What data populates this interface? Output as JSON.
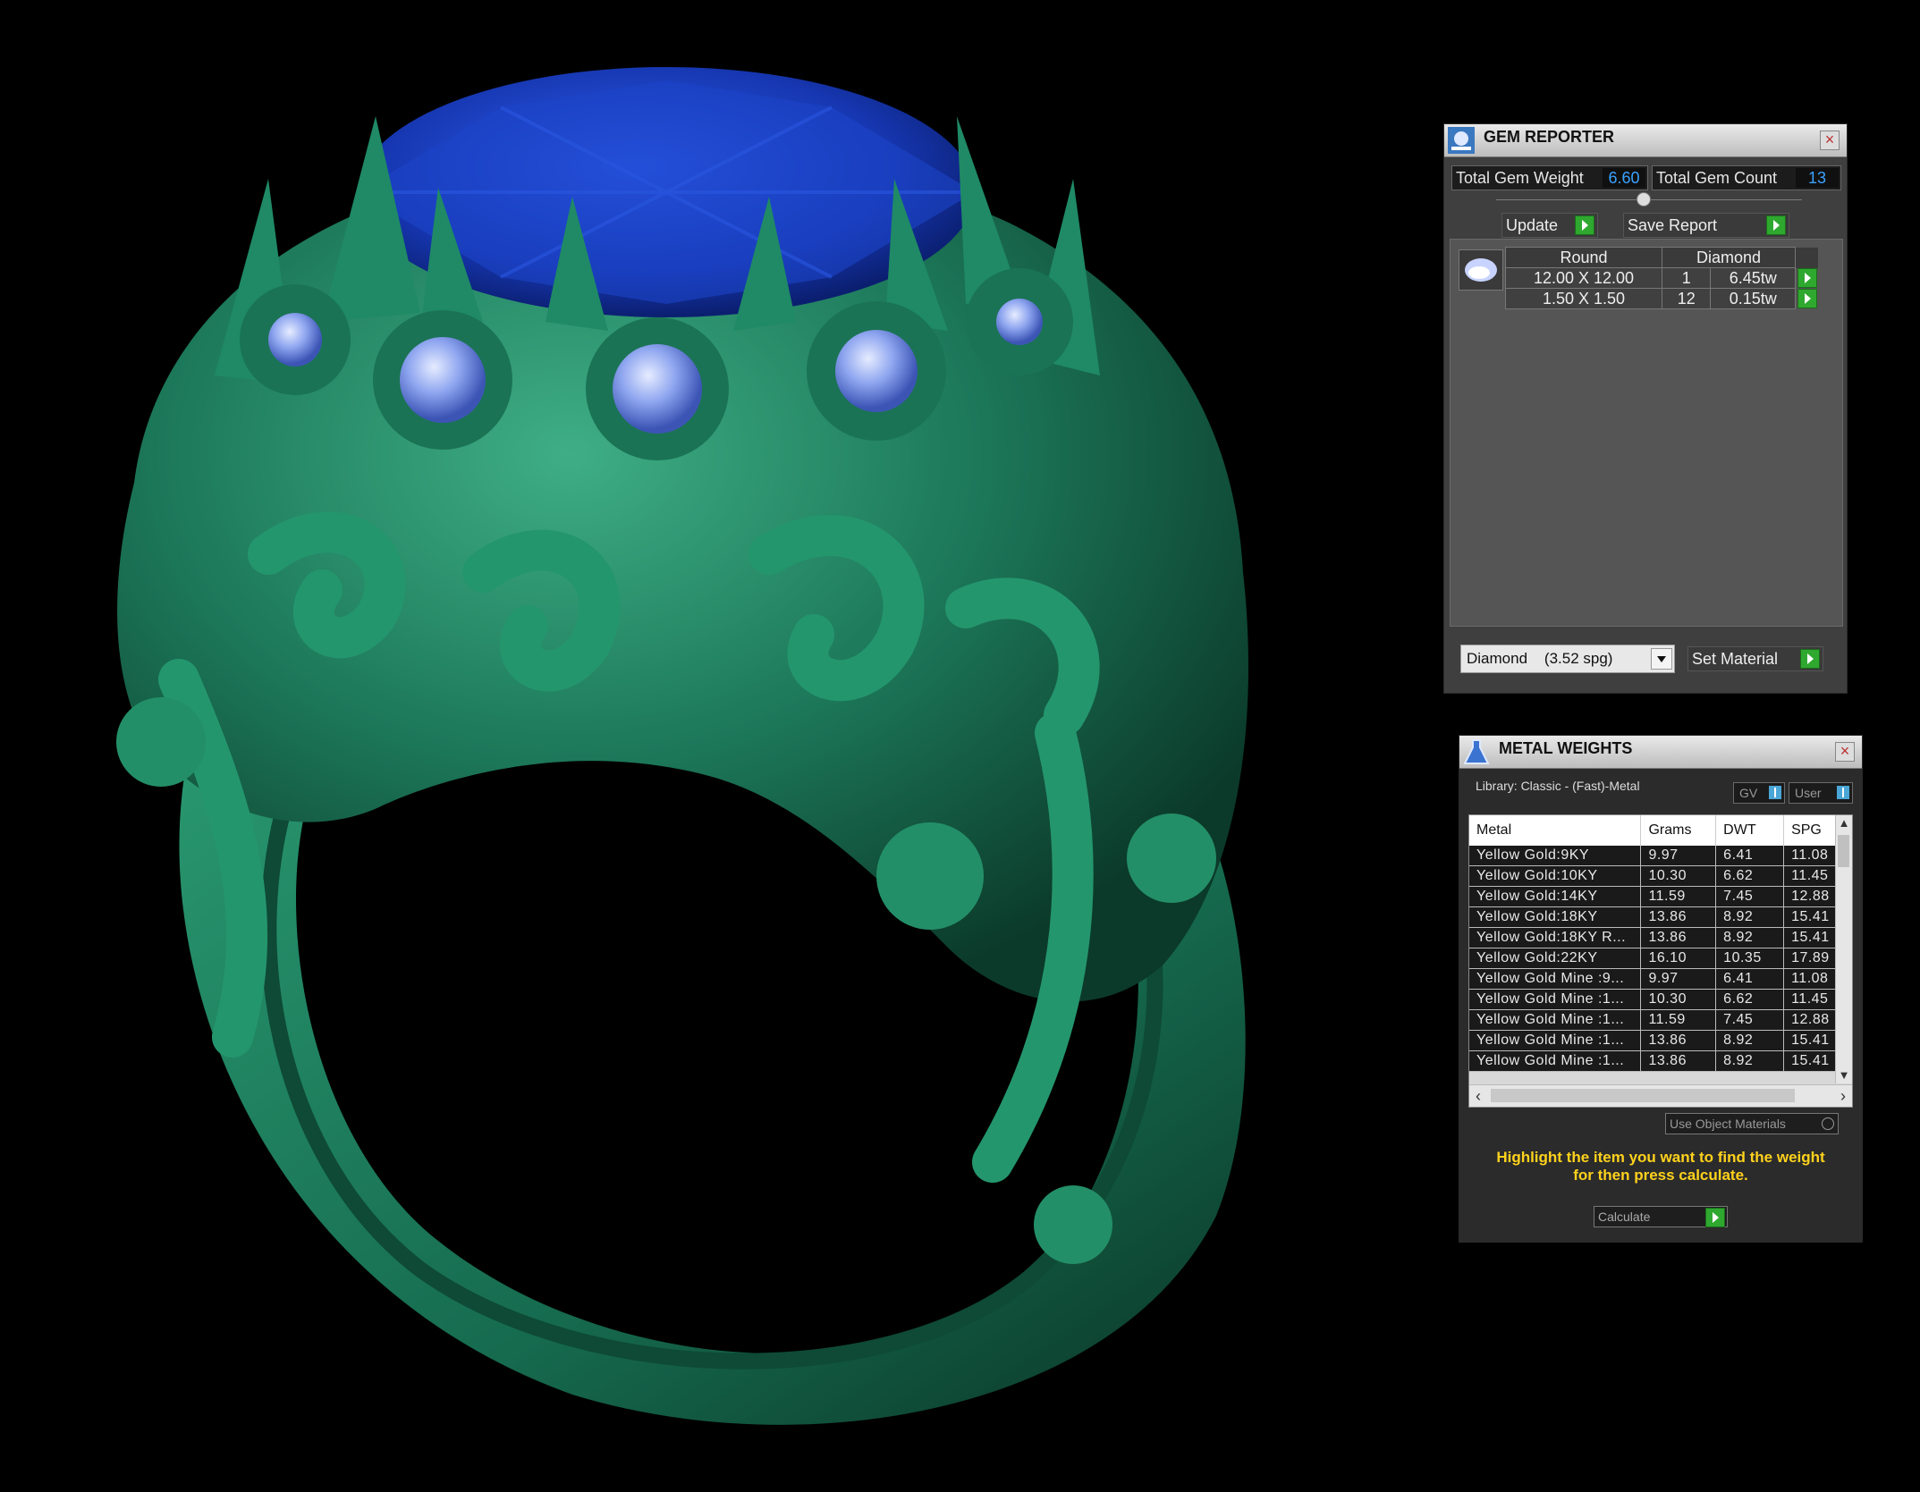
{
  "gem_reporter": {
    "title": "GEM REPORTER",
    "total_weight_label": "Total Gem Weight",
    "total_weight_value": "6.60",
    "total_count_label": "Total Gem Count",
    "total_count_value": "13",
    "update_label": "Update",
    "save_report_label": "Save Report",
    "table_headers": [
      "Round",
      "Diamond"
    ],
    "rows": [
      {
        "size": "12.00 X 12.00",
        "count": "1",
        "weight": "6.45tw"
      },
      {
        "size": "1.50 X 1.50",
        "count": "12",
        "weight": "0.15tw"
      }
    ],
    "material_select": "Diamond    (3.52 spg)",
    "set_material_label": "Set Material"
  },
  "metal_weights": {
    "title": "METAL WEIGHTS",
    "library": "Library: Classic - (Fast)-Metal",
    "toggle_gv": "GV",
    "toggle_user": "User",
    "columns": [
      "Metal",
      "Grams",
      "DWT",
      "SPG"
    ],
    "rows": [
      [
        "Yellow Gold:9KY",
        "9.97",
        "6.41",
        "11.08"
      ],
      [
        "Yellow Gold:10KY",
        "10.30",
        "6.62",
        "11.45"
      ],
      [
        "Yellow Gold:14KY",
        "11.59",
        "7.45",
        "12.88"
      ],
      [
        "Yellow Gold:18KY",
        "13.86",
        "8.92",
        "15.41"
      ],
      [
        "Yellow Gold:18KY R...",
        "13.86",
        "8.92",
        "15.41"
      ],
      [
        "Yellow Gold:22KY",
        "16.10",
        "10.35",
        "17.89"
      ],
      [
        "Yellow Gold Mine :9...",
        "9.97",
        "6.41",
        "11.08"
      ],
      [
        "Yellow Gold Mine :1...",
        "10.30",
        "6.62",
        "11.45"
      ],
      [
        "Yellow Gold Mine :1...",
        "11.59",
        "7.45",
        "12.88"
      ],
      [
        "Yellow Gold Mine :1...",
        "13.86",
        "8.92",
        "15.41"
      ],
      [
        "Yellow Gold Mine :1...",
        "13.86",
        "8.92",
        "15.41"
      ]
    ],
    "use_object_materials": "Use Object Materials",
    "hint_line1": "Highlight the item you want to find the weight",
    "hint_line2": "for then press calculate.",
    "calculate_label": "Calculate"
  },
  "colors": {
    "ring": "#1e7a5c",
    "sapphire": "#1a3fc0",
    "accent_value": "#3aa2ff",
    "hint": "#ffd21c"
  }
}
